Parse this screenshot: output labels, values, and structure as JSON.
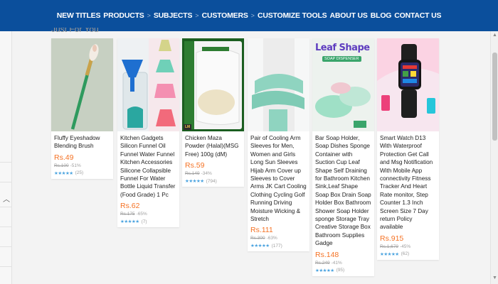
{
  "nav": {
    "items": [
      {
        "label": "NEW TITLES"
      },
      {
        "label": "PRODUCTS"
      },
      {
        "label": "SUBJECTS"
      },
      {
        "label": "CUSTOMERS"
      },
      {
        "label": "CUSTOMIZE TOOLS"
      },
      {
        "label": "ABOUT US"
      },
      {
        "label": "BLOG"
      },
      {
        "label": "CONTACT US"
      }
    ]
  },
  "section_title": "Just For You",
  "products": [
    {
      "title": "Fluffy Eyeshadow Blending Brush",
      "price": "Rs.49",
      "old_price": "Rs.100",
      "discount": "-51%",
      "stars": "★★★★★",
      "reviews": "(25)",
      "icon": "makeup-brush-image"
    },
    {
      "title": "Kitchen Gadgets Silicon Funnel Oil Funnel Water Funnel Kitchen Accessories Silicone Collapsible Funnel For Water Bottle Liquid Transfer (Food Grade) 1 Pc",
      "price": "Rs.62",
      "old_price": "Rs.175",
      "discount": "-65%",
      "stars": "★★★★★",
      "reviews": "(7)",
      "icon": "silicone-funnel-image"
    },
    {
      "title": "Chicken Maza Powder (Halal)(MSG Free) 100g (dM)",
      "price": "Rs.59",
      "old_price": "Rs.149",
      "discount": "-34%",
      "stars": "★★★★★",
      "reviews": "(794)",
      "badge": "LM",
      "icon": "chicken-powder-pack-image"
    },
    {
      "title": "Pair of Cooling Arm Sleeves for Men, Women and Girls Long Sun Sleeves Hijab Arm Cover up Sleeves to Cover Arms JK Cart Cooling Clothing Cycling Golf Running Driving Moisture Wicking & Stretch",
      "price": "Rs.111",
      "old_price": "Rs.300",
      "discount": "-63%",
      "stars": "★★★★★",
      "reviews": "(177)",
      "icon": "arm-sleeves-image"
    },
    {
      "title": "Bar Soap Holder, Soap Dishes Sponge Container with Suction Cup Leaf Shape Self Draining for Bathroom Kitchen Sink,Leaf Shape Soap Box Drain Soap Holder Box Bathroom Shower Soap Holder sponge Storage Tray Creative Storage Box Bathroom Supplies Gadge",
      "price": "Rs.148",
      "old_price": "Rs.249",
      "discount": "-41%",
      "stars": "★★★★★",
      "reviews": "(95)",
      "image_text_1": "Leaf Shape",
      "image_text_2": "SOAP DISPENSER",
      "icon": "leaf-soap-holder-image"
    },
    {
      "title": "Smart Watch D13 With Waterproof Protection Get Call and Msg Notification With Mobile App connectivity Fitness Tracker And Heart Rate monitor, Step Counter 1.3 Inch Screen Size 7 Day return Policy available",
      "price": "Rs.915",
      "old_price": "Rs.1,679",
      "discount": "-45%",
      "stars": "★★★★★",
      "reviews": "(62)",
      "icon": "smart-watch-image"
    }
  ],
  "colors": {
    "nav_bg": "#0b4f9c",
    "price": "#f57224",
    "stars": "#4aa3df"
  }
}
